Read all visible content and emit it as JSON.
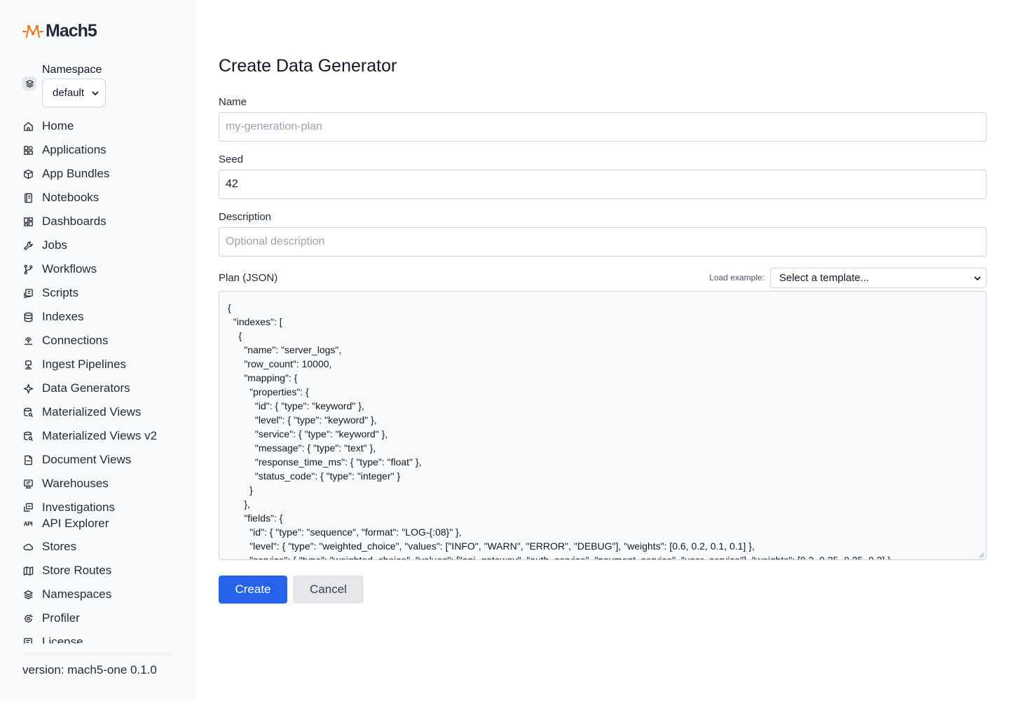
{
  "brand": {
    "name": "Mach5",
    "accent": "#f97316"
  },
  "sidebar": {
    "namespace_label": "Namespace",
    "namespace_value": "default",
    "items": [
      {
        "label": "Home",
        "icon": "home-icon"
      },
      {
        "label": "Applications",
        "icon": "apps-icon"
      },
      {
        "label": "App Bundles",
        "icon": "box-icon"
      },
      {
        "label": "Notebooks",
        "icon": "notebook-icon"
      },
      {
        "label": "Dashboards",
        "icon": "dashboard-icon"
      },
      {
        "label": "Jobs",
        "icon": "wrench-icon"
      },
      {
        "label": "Workflows",
        "icon": "git-branch-icon"
      },
      {
        "label": "Scripts",
        "icon": "script-icon"
      },
      {
        "label": "Indexes",
        "icon": "database-icon"
      },
      {
        "label": "Connections",
        "icon": "connection-icon"
      },
      {
        "label": "Ingest Pipelines",
        "icon": "pipeline-icon"
      },
      {
        "label": "Data Generators",
        "icon": "sparkle-icon"
      },
      {
        "label": "Materialized Views",
        "icon": "db-search-icon"
      },
      {
        "label": "Materialized Views v2",
        "icon": "db-search-icon"
      },
      {
        "label": "Document Views",
        "icon": "document-icon"
      },
      {
        "label": "Warehouses",
        "icon": "warehouse-icon"
      },
      {
        "label": "Investigations",
        "icon": "investigation-icon"
      },
      {
        "label": "API Explorer",
        "icon": "api-icon",
        "badge": "API"
      },
      {
        "label": "Stores",
        "icon": "cloud-icon"
      },
      {
        "label": "Store Routes",
        "icon": "map-icon"
      },
      {
        "label": "Namespaces",
        "icon": "layers-icon"
      },
      {
        "label": "Profiler",
        "icon": "profiler-icon"
      },
      {
        "label": "License",
        "icon": "license-icon"
      }
    ],
    "version": "version: mach5-one 0.1.0"
  },
  "form": {
    "title": "Create Data Generator",
    "name_label": "Name",
    "name_placeholder": "my-generation-plan",
    "seed_label": "Seed",
    "seed_value": "42",
    "description_label": "Description",
    "description_placeholder": "Optional description",
    "plan_label": "Plan (JSON)",
    "load_example_label": "Load example:",
    "template_select_value": "Select a template...",
    "plan_text": "{\n  \"indexes\": [\n    {\n      \"name\": \"server_logs\",\n      \"row_count\": 10000,\n      \"mapping\": {\n        \"properties\": {\n          \"id\": { \"type\": \"keyword\" },\n          \"level\": { \"type\": \"keyword\" },\n          \"service\": { \"type\": \"keyword\" },\n          \"message\": { \"type\": \"text\" },\n          \"response_time_ms\": { \"type\": \"float\" },\n          \"status_code\": { \"type\": \"integer\" }\n        }\n      },\n      \"fields\": {\n        \"id\": { \"type\": \"sequence\", \"format\": \"LOG-{:08}\" },\n        \"level\": { \"type\": \"weighted_choice\", \"values\": [\"INFO\", \"WARN\", \"ERROR\", \"DEBUG\"], \"weights\": [0.6, 0.2, 0.1, 0.1] },\n        \"service\": { \"type\": \"weighted_choice\", \"values\": [\"api_gateway\", \"auth_service\", \"payment_service\", \"user_service\"], \"weights\": [0.3, 0.25, 0.25, 0.2] },",
    "create_label": "Create",
    "cancel_label": "Cancel",
    "primary_color": "#2563eb"
  }
}
